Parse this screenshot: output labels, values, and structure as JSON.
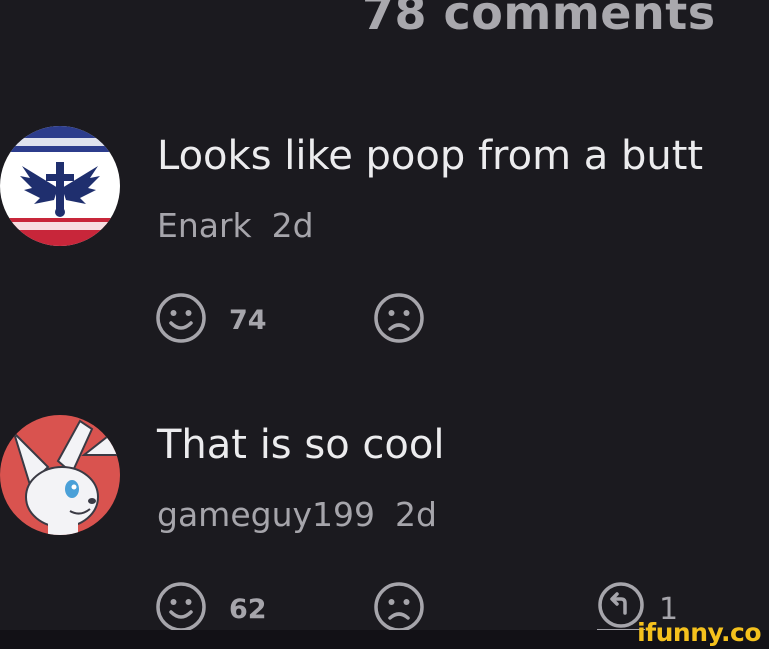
{
  "header": {
    "title": "78 comments"
  },
  "comments": [
    {
      "text": "Looks like poop from a butt",
      "author": "Enark",
      "time": "2d",
      "likes": "74",
      "avatar_icon": "emblem-avatar-icon"
    },
    {
      "text": "That is so cool",
      "author": "gameguy199",
      "time": "2d",
      "likes": "62",
      "replies": "1",
      "avatar_icon": "fox-avatar-icon"
    }
  ],
  "watermark": "ifunny.co",
  "colors": {
    "background": "#1b1a1f",
    "text": "#ececee",
    "muted": "#a6a5ab",
    "watermark": "#f4c11d"
  }
}
